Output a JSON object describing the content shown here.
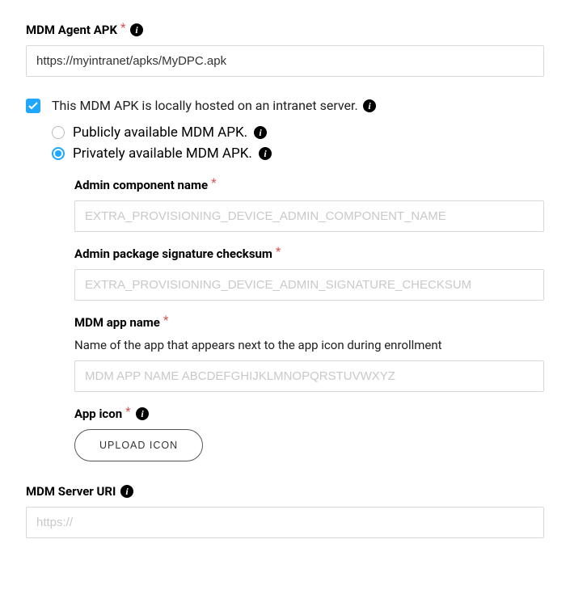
{
  "mdmAgent": {
    "label": "MDM Agent APK",
    "value": "https://myintranet/apks/MyDPC.apk"
  },
  "locallyHosted": {
    "label": "This MDM APK is locally hosted on an intranet server.",
    "checked": true
  },
  "availability": {
    "public": "Publicly available MDM APK.",
    "private": "Privately available MDM APK.",
    "selected": "private"
  },
  "adminComponent": {
    "label": "Admin component name",
    "placeholder": "EXTRA_PROVISIONING_DEVICE_ADMIN_COMPONENT_NAME"
  },
  "signatureChecksum": {
    "label": "Admin package signature checksum",
    "placeholder": "EXTRA_PROVISIONING_DEVICE_ADMIN_SIGNATURE_CHECKSUM"
  },
  "mdmAppName": {
    "label": "MDM app name",
    "hint": "Name of the app that appears next to the app icon during enrollment",
    "placeholder": "MDM APP NAME ABCDEFGHIJKLMNOPQRSTUVWXYZ"
  },
  "appIcon": {
    "label": "App icon",
    "button": "UPLOAD ICON"
  },
  "serverUri": {
    "label": "MDM Server URI",
    "placeholder": "https://"
  }
}
